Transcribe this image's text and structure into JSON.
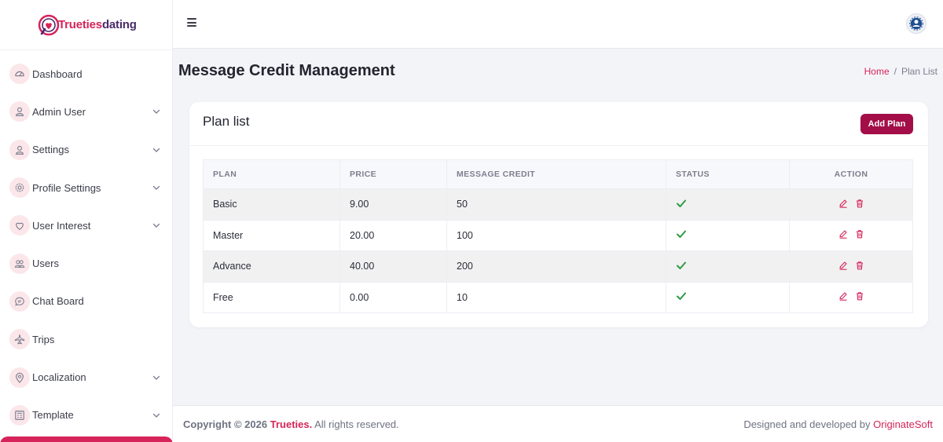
{
  "app": {
    "logo_part1": "Trueties",
    "logo_part2": "dating"
  },
  "colors": {
    "accent": "#d6245a",
    "button": "#a30d48",
    "status_ok": "#2e9b45"
  },
  "sidebar": {
    "items": [
      {
        "label": "Dashboard",
        "icon": "dashboard-icon",
        "has_chevron": false
      },
      {
        "label": "Admin User",
        "icon": "user-icon",
        "has_chevron": true
      },
      {
        "label": "Settings",
        "icon": "user-icon",
        "has_chevron": true
      },
      {
        "label": "Profile Settings",
        "icon": "gear-icon",
        "has_chevron": true
      },
      {
        "label": "User Interest",
        "icon": "heart-icon",
        "has_chevron": true
      },
      {
        "label": "Users",
        "icon": "users-icon",
        "has_chevron": false
      },
      {
        "label": "Chat Board",
        "icon": "chat-icon",
        "has_chevron": false
      },
      {
        "label": "Trips",
        "icon": "plane-icon",
        "has_chevron": false
      },
      {
        "label": "Localization",
        "icon": "location-pin-icon",
        "has_chevron": true
      },
      {
        "label": "Template",
        "icon": "template-icon",
        "has_chevron": true
      }
    ]
  },
  "header": {
    "page_title": "Message Credit Management",
    "breadcrumb_home": "Home",
    "breadcrumb_sep": "/",
    "breadcrumb_current": "Plan List"
  },
  "card": {
    "title": "Plan list",
    "add_button": "Add Plan"
  },
  "table": {
    "columns": [
      "PLAN",
      "PRICE",
      "MESSAGE CREDIT",
      "STATUS",
      "ACTION"
    ],
    "rows": [
      {
        "plan": "Basic",
        "price": "9.00",
        "credit": "50",
        "status": "active"
      },
      {
        "plan": "Master",
        "price": "20.00",
        "credit": "100",
        "status": "active"
      },
      {
        "plan": "Advance",
        "price": "40.00",
        "credit": "200",
        "status": "active"
      },
      {
        "plan": "Free",
        "price": "0.00",
        "credit": "10",
        "status": "active"
      }
    ]
  },
  "footer": {
    "copyright_prefix": "Copyright © 2026",
    "brand": "Trueties.",
    "rights": "All rights reserved.",
    "designed_by": "Designed and developed by",
    "developer": "OriginateSoft"
  }
}
